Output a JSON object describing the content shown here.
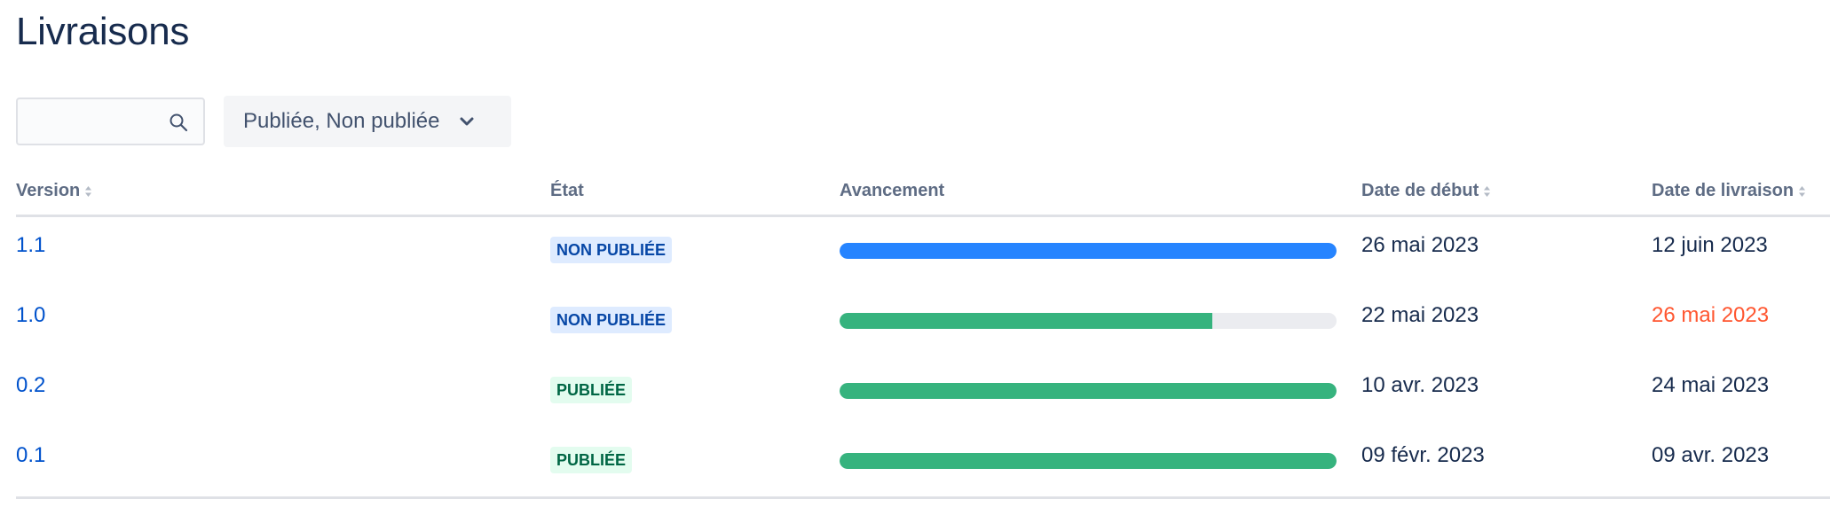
{
  "page": {
    "title": "Livraisons"
  },
  "search": {
    "value": "",
    "placeholder": ""
  },
  "filter": {
    "label": "Publiée, Non publiée"
  },
  "colors": {
    "link": "#0052cc",
    "progress_blue": "#2684ff",
    "progress_green": "#36b37e",
    "overdue": "#ff5630"
  },
  "table": {
    "headers": {
      "version": "Version",
      "status": "État",
      "progress": "Avancement",
      "start_date": "Date de début",
      "release_date": "Date de livraison"
    },
    "rows": [
      {
        "version": "1.1",
        "status": "NON PUBLIÉE",
        "status_kind": "unreleased",
        "progress": 1.0,
        "progress_color": "blue",
        "start_date": "26 mai 2023",
        "release_date": "12 juin 2023",
        "overdue": false
      },
      {
        "version": "1.0",
        "status": "NON PUBLIÉE",
        "status_kind": "unreleased",
        "progress": 0.75,
        "progress_color": "green",
        "start_date": "22 mai 2023",
        "release_date": "26 mai 2023",
        "overdue": true
      },
      {
        "version": "0.2",
        "status": "PUBLIÉE",
        "status_kind": "released",
        "progress": 1.0,
        "progress_color": "green",
        "start_date": "10 avr. 2023",
        "release_date": "24 mai 2023",
        "overdue": false
      },
      {
        "version": "0.1",
        "status": "PUBLIÉE",
        "status_kind": "released",
        "progress": 1.0,
        "progress_color": "green",
        "start_date": "09 févr. 2023",
        "release_date": "09 avr. 2023",
        "overdue": false
      }
    ]
  }
}
